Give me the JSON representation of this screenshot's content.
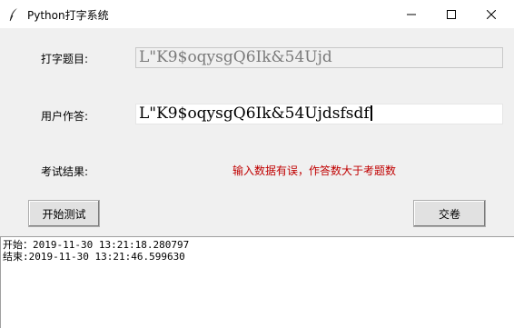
{
  "window": {
    "title": "Python打字系统",
    "icons": {
      "app": "feather-icon",
      "minimize": "minimize-icon",
      "maximize": "maximize-icon",
      "close": "close-icon"
    }
  },
  "form": {
    "question_label": "打字题目:",
    "question_value": "L\"K9$oqysgQ6Ik&54Ujd",
    "answer_label": "用户作答:",
    "answer_value": "L\"K9$oqysgQ6Ik&54Ujdsfsdf",
    "result_label": "考试结果:",
    "result_message": "输入数据有误，作答数大于考题数"
  },
  "buttons": {
    "start_label": "开始测试",
    "submit_label": "交卷"
  },
  "log": {
    "lines": [
      "开始：2019-11-30 13:21:18.280797",
      "结束:2019-11-30 13:21:46.599630"
    ]
  },
  "colors": {
    "error_text": "#c00000",
    "background": "#f0f0f0"
  }
}
